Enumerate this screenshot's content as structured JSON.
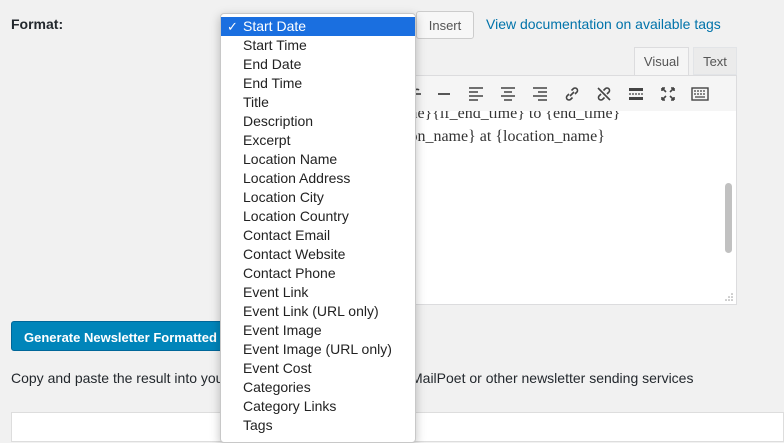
{
  "format_label": "Format:",
  "insert_label": "Insert",
  "doc_link": "View documentation on available tags",
  "tabs": {
    "visual": "Visual",
    "text": "Text"
  },
  "toolbar_icons": [
    "strikethrough-icon",
    "horizontal-rule-icon",
    "align-left-icon",
    "align-center-icon",
    "align-right-icon",
    "link-icon",
    "unlink-icon",
    "read-more-icon",
    "fullscreen-icon",
    "toolbar-toggle-icon"
  ],
  "editor": {
    "line1": "me}{if_end_time} to {end_time}",
    "line2": "ion_name} at {location_name}"
  },
  "generate_button": "Generate Newsletter Formatted Eve",
  "copy_text_left": "Copy and paste the result into you",
  "copy_text_right": "MailPoet or other newsletter sending services",
  "dropdown": {
    "selected_check": "✓",
    "options": [
      "Start Date",
      "Start Time",
      "End Date",
      "End Time",
      "Title",
      "Description",
      "Excerpt",
      "Location Name",
      "Location Address",
      "Location City",
      "Location Country",
      "Contact Email",
      "Contact Website",
      "Contact Phone",
      "Event Link",
      "Event Link (URL only)",
      "Event Image",
      "Event Image (URL only)",
      "Event Cost",
      "Categories",
      "Category Links",
      "Tags"
    ]
  },
  "colors": {
    "accent_blue": "#0085ba",
    "link": "#0073aa",
    "selection": "#1a6fe0",
    "background": "#f1f1f1"
  }
}
